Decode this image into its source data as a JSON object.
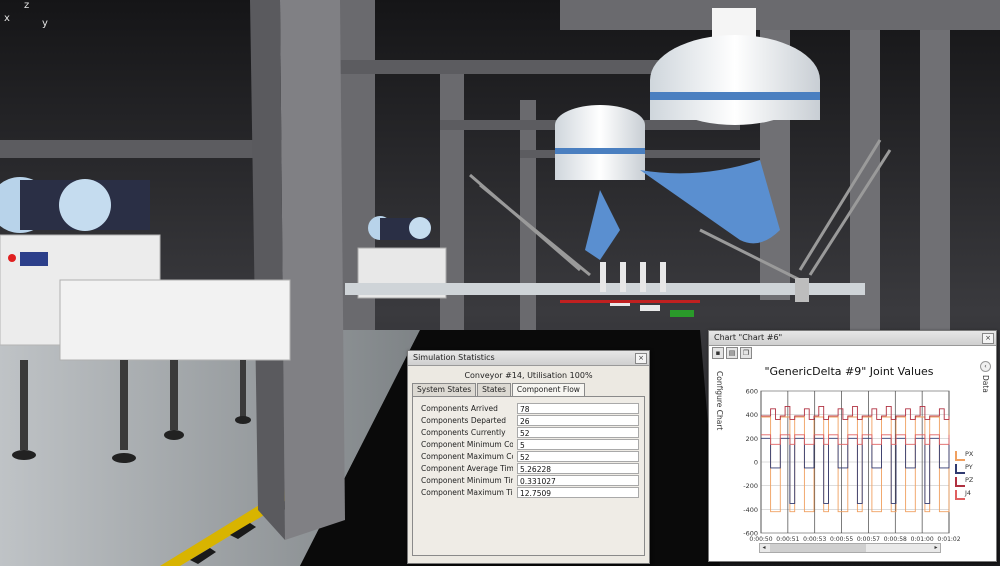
{
  "viewport_axes": {
    "x": "x",
    "y": "y",
    "z": "z"
  },
  "stats_panel": {
    "title": "Simulation Statistics",
    "close": "×",
    "subtitle": "Conveyor #14, Utilisation 100%",
    "tabs": [
      "System States",
      "States",
      "Component Flow"
    ],
    "active_tab": "Component Flow",
    "rows": [
      {
        "label": "Components Arrived",
        "value": "78"
      },
      {
        "label": "Components Departed",
        "value": "26"
      },
      {
        "label": "Components Currently",
        "value": "52"
      },
      {
        "label": "Component Minimum Count",
        "value": "5"
      },
      {
        "label": "Component Maximum Count",
        "value": "52"
      },
      {
        "label": "Component Average Time (s)",
        "value": "5.26228"
      },
      {
        "label": "Component Minimum Time (s)",
        "value": "0.331027"
      },
      {
        "label": "Component Maximum Time (s)",
        "value": "12.7509"
      }
    ]
  },
  "chart_window": {
    "title": "Chart \"Chart #6\"",
    "close": "×",
    "left_side_label": "Configure Chart",
    "right_side_label": "Data",
    "collapse": "‹",
    "toolbar_icons": [
      "save-icon",
      "print-icon",
      "copy-icon"
    ],
    "scroll_left": "◂",
    "scroll_right": "▸"
  },
  "chart_data": {
    "type": "line",
    "title": "\"GenericDelta #9\" Joint Values",
    "xlabel": "",
    "ylabel": "",
    "ylim": [
      -600,
      600
    ],
    "y_ticks": [
      600,
      400,
      200,
      0,
      -200,
      -400,
      -600
    ],
    "x_ticks": [
      "0:00:50",
      "0:00:51",
      "0:00:53",
      "0:00:55",
      "0:00:57",
      "0:00:58",
      "0:01:00",
      "0:01:02"
    ],
    "grid": true,
    "legend_position": "right",
    "series": [
      {
        "name": "PX",
        "color": "#f0a060",
        "values": [
          380,
          380,
          -420,
          -420,
          380,
          380,
          -420,
          380,
          380,
          -420,
          -420,
          380,
          380,
          -420,
          380,
          380,
          -420,
          -420,
          380,
          380,
          -420,
          380,
          380,
          -420,
          -420,
          380,
          380,
          -420,
          380,
          380,
          -420,
          -420,
          380,
          380,
          -420,
          380,
          380,
          -420,
          -420,
          380
        ]
      },
      {
        "name": "PY",
        "color": "#303a70",
        "values": [
          200,
          200,
          -50,
          -50,
          200,
          200,
          -350,
          200,
          200,
          -50,
          -50,
          200,
          200,
          -350,
          200,
          200,
          -50,
          -50,
          200,
          200,
          -350,
          200,
          200,
          -50,
          -50,
          200,
          200,
          -350,
          200,
          200,
          -50,
          -50,
          200,
          200,
          -350,
          200,
          200,
          -50,
          -50,
          200
        ]
      },
      {
        "name": "PZ",
        "color": "#b03040",
        "values": [
          390,
          390,
          450,
          360,
          390,
          470,
          360,
          390,
          390,
          450,
          360,
          390,
          470,
          360,
          390,
          390,
          450,
          360,
          390,
          470,
          360,
          390,
          390,
          450,
          360,
          390,
          470,
          360,
          390,
          390,
          450,
          360,
          390,
          470,
          360,
          390,
          390,
          450,
          360,
          390
        ]
      },
      {
        "name": "J4",
        "color": "#e06060",
        "values": [
          230,
          230,
          150,
          150,
          230,
          230,
          150,
          230,
          230,
          150,
          150,
          230,
          230,
          150,
          230,
          230,
          150,
          150,
          230,
          230,
          150,
          230,
          230,
          150,
          150,
          230,
          230,
          150,
          230,
          230,
          150,
          150,
          230,
          230,
          150,
          230,
          230,
          150,
          150,
          230
        ]
      }
    ]
  }
}
